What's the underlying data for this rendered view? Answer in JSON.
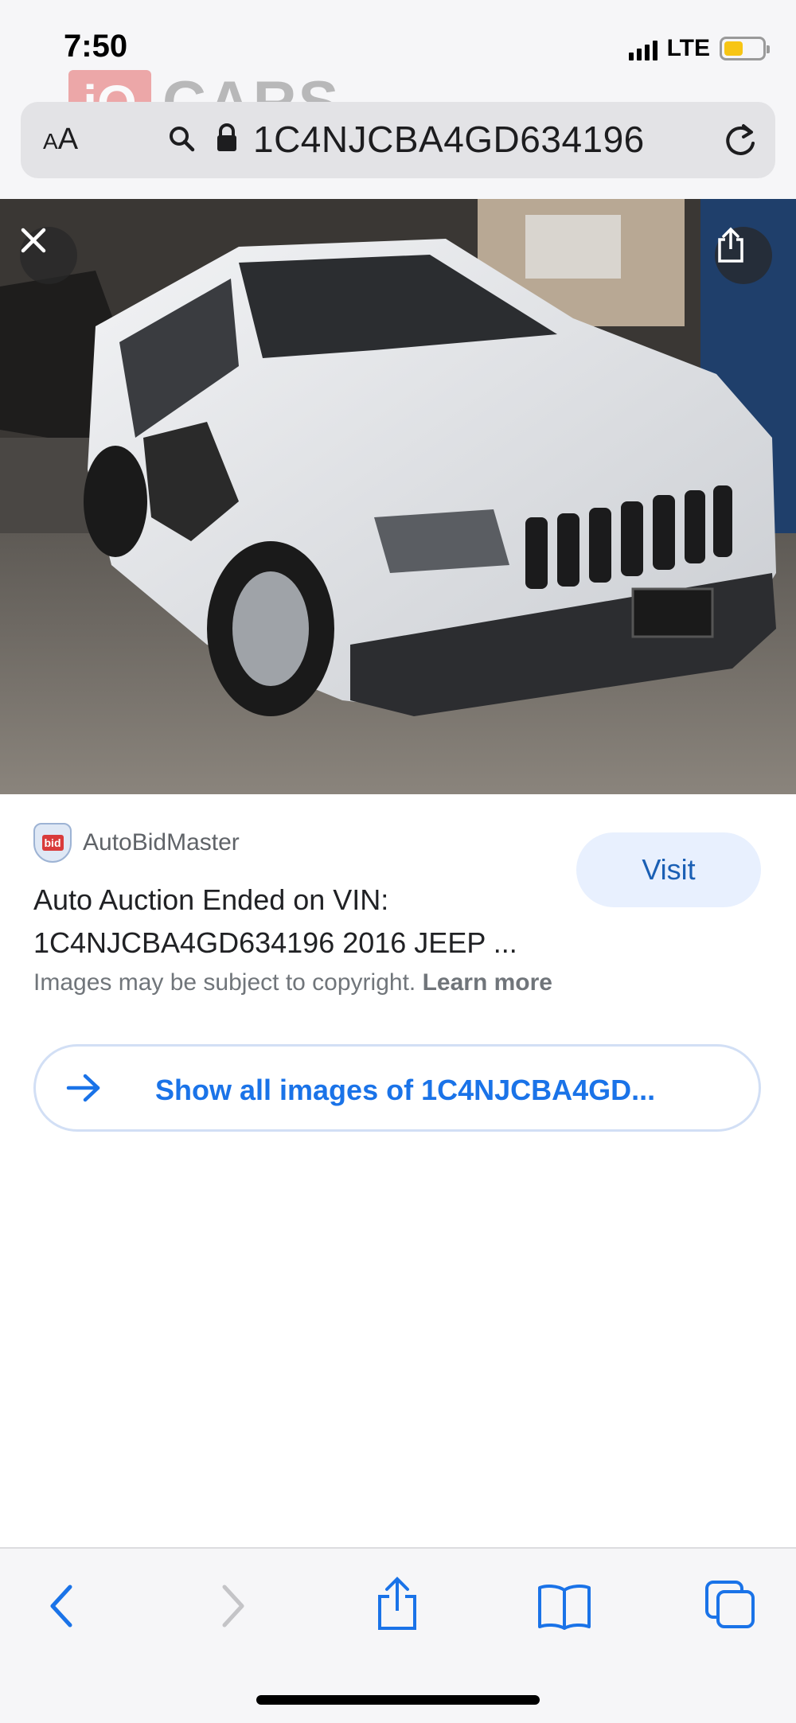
{
  "status_bar": {
    "time": "7:50",
    "network": "LTE",
    "battery_level": 0.5,
    "battery_color": "#f7c514"
  },
  "watermark": {
    "logo_letters": "iQ",
    "logo_text": "CARS"
  },
  "url_bar": {
    "text_size_small": "A",
    "text_size_large": "A",
    "url": "1C4NJCBA4GD634196",
    "icons": [
      "search-icon",
      "lock-icon",
      "reload-icon"
    ]
  },
  "image_viewer": {
    "close_icon": "close-icon",
    "share_icon": "share-icon"
  },
  "result": {
    "source_name": "AutoBidMaster",
    "source_logo_text": "bid",
    "visit_label": "Visit",
    "title_line1": "Auto Auction Ended on VIN:",
    "title_line2": "1C4NJCBA4GD634196 2016 JEEP ...",
    "copyright_text": "Images may be subject to copyright.",
    "learn_more": "Learn more",
    "show_all_label": "Show all images of 1C4NJCBA4GD..."
  },
  "toolbar": {
    "items": [
      "back-icon",
      "forward-icon",
      "share-icon",
      "bookmarks-icon",
      "tabs-icon"
    ]
  },
  "colors": {
    "accent": "#1a73e8",
    "visit_bg": "#e8f0fe",
    "chrome_bg": "#f6f6f8"
  }
}
